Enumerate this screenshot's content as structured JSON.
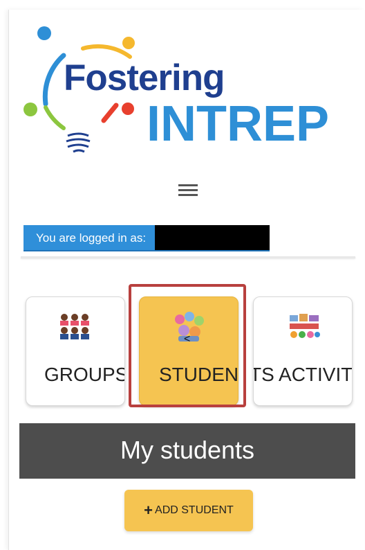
{
  "logo": {
    "line1": "Fostering",
    "line2": "INTREP"
  },
  "menu": {
    "icon": "hamburger-menu-icon"
  },
  "login": {
    "label": "You are logged in as:",
    "username_redacted": true
  },
  "cards": [
    {
      "label": "GROUPS",
      "icon": "groups-icon",
      "active": false
    },
    {
      "label": "STUDENTS",
      "icon": "students-icon",
      "active": true
    },
    {
      "label": "STUDENTS ACTIVITIES",
      "visible_text": "TS ACTIVITI",
      "icon": "activities-icon",
      "active": false
    }
  ],
  "cursor_glyph": "<",
  "section": {
    "title": "My students"
  },
  "add_button": {
    "plus": "+",
    "label": "ADD STUDENT"
  },
  "colors": {
    "accent_yellow": "#f5c451",
    "login_blue": "#2f8fd9",
    "header_gray": "#4d4d4d",
    "highlight_red": "#b8403e",
    "logo_dark_blue": "#1f3f8f",
    "logo_light_blue": "#2e8fd6"
  }
}
